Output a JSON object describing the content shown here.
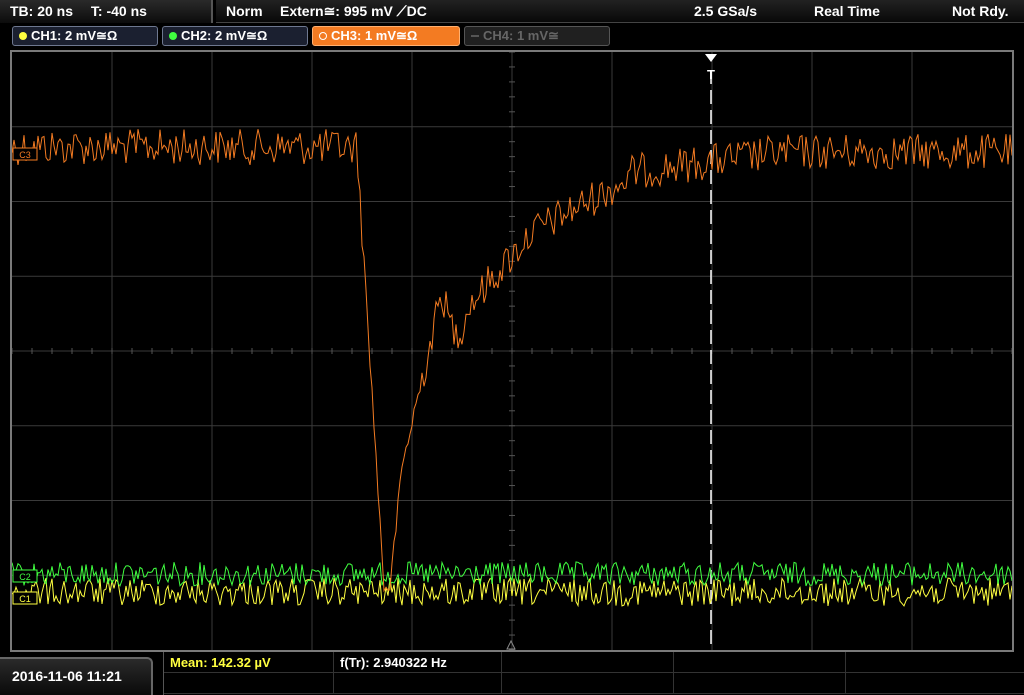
{
  "top": {
    "timebase": "TB: 20 ns",
    "trigger_time": "T: -40 ns",
    "mode": "Norm",
    "trigger_source": "Extern≅: 995 mV ⟋DC",
    "sample_rate": "2.5 GSa/s",
    "acq_mode": "Real Time",
    "state": "Not Rdy."
  },
  "channels": [
    {
      "label": "CH1: 2 mV≅Ω",
      "color": "#ffff40",
      "active": false,
      "enabled": true
    },
    {
      "label": "CH2: 2 mV≅Ω",
      "color": "#40ff40",
      "active": false,
      "enabled": true
    },
    {
      "label": "CH3: 1 mV≅Ω",
      "color": "#f37b22",
      "active": true,
      "enabled": true
    },
    {
      "label": "CH4: 1 mV≅",
      "color": "#666666",
      "active": false,
      "enabled": false
    }
  ],
  "markers": {
    "ch3": "C3",
    "ch2": "C2",
    "ch1": "C1",
    "trigger": "T"
  },
  "bottom": {
    "datetime": "2016-11-06 11:21",
    "mean": "Mean: 142.32 µV",
    "freq": "f(Tr): 2.940322 Hz"
  },
  "colors": {
    "ch1": "#ffff40",
    "ch2": "#40ff40",
    "ch3": "#f37b22",
    "grid": "#3a3a3a",
    "mean_text": "#ffff40"
  }
}
